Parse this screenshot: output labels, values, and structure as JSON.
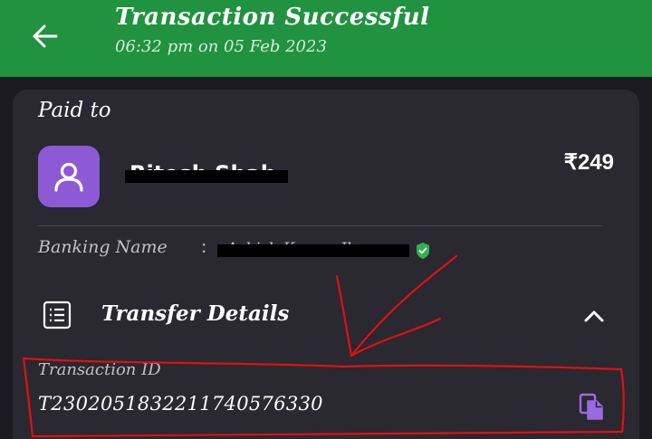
{
  "header": {
    "title": "Transaction Successful",
    "subtitle": "06:32 pm on 05 Feb 2023",
    "back_icon": "arrow-left-icon",
    "background": "#21923f"
  },
  "card": {
    "paid_to_label": "Paid to",
    "payee_name": "Ritesh Shah",
    "amount": "₹249",
    "avatar_icon": "person-icon",
    "avatar_color": "#8d5ad6",
    "banking_name_label": "Banking Name",
    "banking_name_separator": ":",
    "banking_name_value": "Ashish Kumar Jha",
    "verified_icon": "verified-shield-icon",
    "verified_color": "#2fb24f"
  },
  "transfer_details": {
    "label": "Transfer Details",
    "icon": "list-icon",
    "chevron_icon": "chevron-up-icon",
    "expanded": true,
    "transaction_id_label": "Transaction ID",
    "transaction_id": "T2302051832211740576330",
    "copy_icon": "copy-icon",
    "copy_color": "#9c6ae0"
  },
  "annotation": {
    "color": "#e01010",
    "shapes": [
      "red-arrow",
      "red-highlight-box"
    ]
  }
}
